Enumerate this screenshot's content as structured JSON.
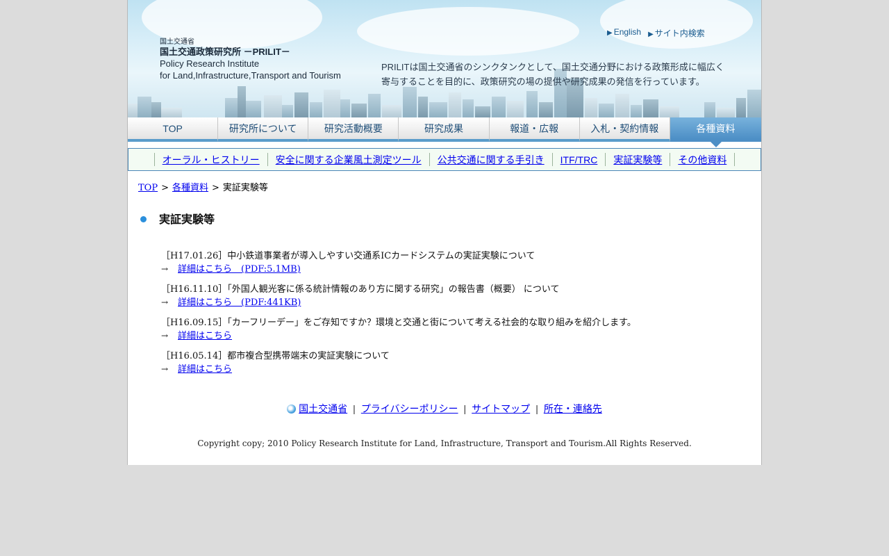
{
  "header": {
    "logo": {
      "line1": "国土交通省",
      "line2": "国土交通政策研究所 －PRILIT－",
      "line3": "Policy Research Institute",
      "line4": "for Land,Infrastructure,Transport and Tourism"
    },
    "top_links": [
      "English",
      "サイト内検索"
    ],
    "tagline_line1": "PRILITは国土交通省のシンクタンクとして、国土交通分野における政策形成に幅広く",
    "tagline_line2": "寄与することを目的に、政策研究の場の提供や研究成果の発信を行っています。"
  },
  "global_nav": {
    "items": [
      "TOP",
      "研究所について",
      "研究活動概要",
      "研究成果",
      "報道・広報",
      "入札・契約情報",
      "各種資料"
    ],
    "active": "各種資料"
  },
  "sub_nav": {
    "items": [
      "オーラル・ヒストリー",
      "安全に関する企業風土測定ツール",
      "公共交通に関する手引き",
      "ITF/TRC",
      "実証実験等",
      "その他資料"
    ]
  },
  "breadcrumb": {
    "items": [
      "TOP",
      "各種資料",
      "実証実験等"
    ],
    "separator": ">"
  },
  "page_title": "実証実験等",
  "news": [
    {
      "date": "［H17.01.26］",
      "title": "中小鉄道事業者が導入しやすい交通系ICカードシステムの実証実験について",
      "arrow": "→",
      "link": "詳細はこちら　(PDF:5.1MB)"
    },
    {
      "date": "［H16.11.10］",
      "title": "「外国人観光客に係る統計情報のあり方に関する研究」の報告書（概要） について",
      "arrow": "→",
      "link": "詳細はこちら　(PDF:441KB)"
    },
    {
      "date": "［H16.09.15］",
      "title": "「カーフリーデー」をご存知ですか？環境と交通と街について考える社会的な取り組みを紹介します。",
      "arrow": "→",
      "link": "詳細はこちら"
    },
    {
      "date": "［H16.05.14］",
      "title": "都市複合型携帯端末の実証実験について",
      "arrow": "→",
      "link": "詳細はこちら"
    }
  ],
  "footer": {
    "links": [
      "国土交通省",
      "プライバシーポリシー",
      "サイトマップ",
      "所在・連絡先"
    ],
    "separator": "|",
    "copyright": "Copyright copy; 2010 Policy Research Institute for Land, Infrastructure, Transport and Tourism.All Rights Reserved."
  },
  "colors": {
    "page_bg": "#dcdcdc",
    "nav_active": "#4d8fc6",
    "link": "#0000ee",
    "subnav_border": "#4a86b8",
    "bullet": "#2b8fdc"
  },
  "icons": [
    "triangle-right-icon",
    "mlit-logo-icon",
    "bullet-dot-icon"
  ]
}
